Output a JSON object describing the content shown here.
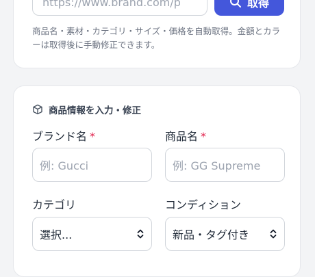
{
  "url_bar": {
    "value": "https://www.brand.com/p",
    "fetch_label": "取得",
    "fetch_icon": "search-icon"
  },
  "help_text": "商品名・素材・カテゴリ・サイズ・価格を自動取得。金額とカラーは取得後に手動修正できます。",
  "product_section": {
    "title": "商品情報を入力・修正",
    "title_icon": "box-icon",
    "fields": {
      "brand": {
        "label": "ブランド名",
        "required_mark": "*",
        "placeholder": "例: Gucci"
      },
      "product_name": {
        "label": "商品名",
        "required_mark": "*",
        "placeholder": "例: GG Supreme"
      },
      "category": {
        "label": "カテゴリ",
        "value": "選択..."
      },
      "condition": {
        "label": "コンディション",
        "value": "新品・タグ付き"
      }
    }
  },
  "colors": {
    "accent": "#4457db",
    "required": "#e11d48",
    "border": "#d1d5db",
    "page_background": "#f3f4f6"
  }
}
